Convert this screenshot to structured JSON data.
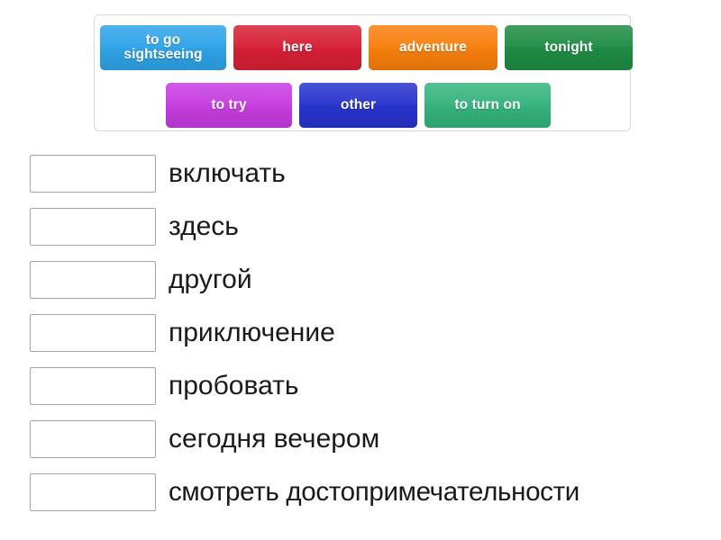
{
  "word_bank": {
    "rows": [
      [
        {
          "label": "to go sightseeing",
          "color": "#2ea3e8",
          "name": "tile-to-go-sightseeing"
        },
        {
          "label": "here",
          "color": "#d61f35",
          "name": "tile-here"
        },
        {
          "label": "adventure",
          "color": "#f77f0c",
          "name": "tile-adventure"
        },
        {
          "label": "tonight",
          "color": "#1e8c43",
          "name": "tile-tonight"
        }
      ],
      [
        {
          "label": "to try",
          "color": "#c63ce0",
          "name": "tile-to-try"
        },
        {
          "label": "other",
          "color": "#2733cc",
          "name": "tile-other"
        },
        {
          "label": "to turn on",
          "color": "#34b37c",
          "name": "tile-to-turn-on"
        }
      ]
    ]
  },
  "answers": [
    {
      "label": "включать"
    },
    {
      "label": "здесь"
    },
    {
      "label": "другой"
    },
    {
      "label": "приключение"
    },
    {
      "label": "пробовать"
    },
    {
      "label": "сегодня вечером"
    },
    {
      "label": "смотреть достопримечательности"
    }
  ],
  "colors": {
    "panel_border": "#d8d8d8",
    "box_border": "#a5a5a5",
    "text": "#1a1a1a",
    "background": "#ffffff"
  }
}
